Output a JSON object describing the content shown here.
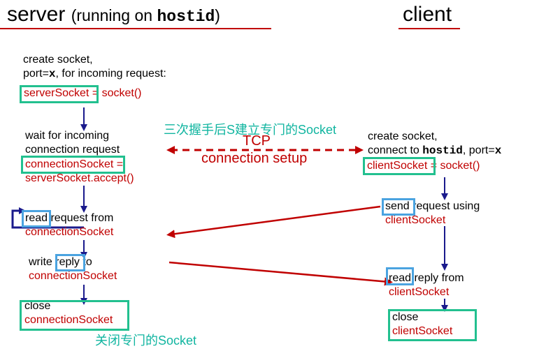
{
  "server": {
    "title_main": "server",
    "title_paren_open": "(running",
    "title_on": "on",
    "title_host": "hostid",
    "title_paren_close": ")",
    "create_line1": "create socket,",
    "create_line2_a": "port=",
    "create_line2_x": "x",
    "create_line2_b": ", for incoming request:",
    "server_socket": "serverSocket",
    "server_socket_rest": " = socket()",
    "wait_line1": "wait for incoming",
    "wait_line2": "connection request",
    "conn_socket": "connectionSocket",
    "conn_socket_eq": " =",
    "accept": "serverSocket.accept()",
    "read": "read",
    "read_rest": " request from",
    "read_src": "connectionSocket",
    "write": "write ",
    "reply": "reply",
    "write_to": " to",
    "write_dst": "connectionSocket",
    "close": "close",
    "close_sock": "connectionSocket"
  },
  "client": {
    "title": "client",
    "create_line1": "create socket,",
    "connect_a": "connect to ",
    "connect_host": "hostid",
    "connect_b": ", port=",
    "connect_x": "x",
    "client_socket": "clientSocket",
    "client_socket_rest": " = socket()",
    "send": "send",
    "send_rest": " request using",
    "send_sock": "clientSocket",
    "read": "read",
    "read_rest": " reply from",
    "read_sock": "clientSocket",
    "close": "close",
    "close_sock": "clientSocket"
  },
  "middle": {
    "handshake_note": "三次握手后S建立专门的Socket",
    "tcp": "TCP",
    "setup": "connection setup",
    "close_note": "关闭专门的Socket"
  },
  "colors": {
    "red": "#c00000",
    "navy": "#1a1a8c",
    "green_box": "#22c08f",
    "blue_box": "#4aa3e0",
    "note": "#11b5a0"
  }
}
